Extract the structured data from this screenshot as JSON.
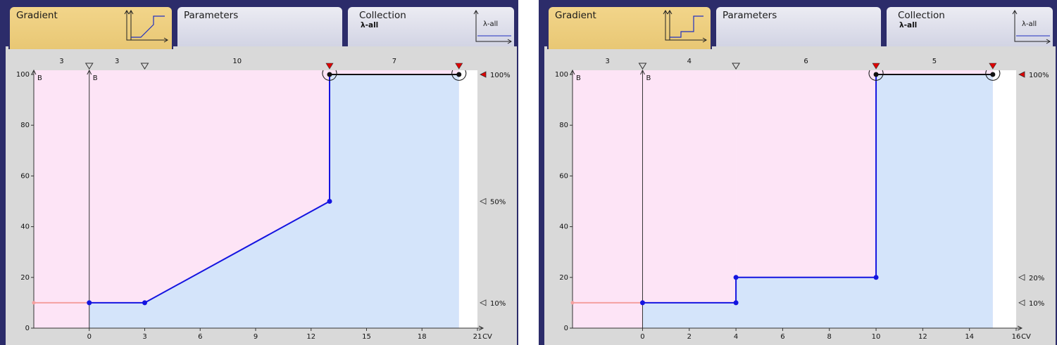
{
  "tabs": {
    "gradient_label": "Gradient",
    "parameters_label": "Parameters",
    "collection_label": "Collection",
    "collection_sub": "λ-all",
    "lambda_icon_text": "λ-all"
  },
  "colors": {
    "frame": "#2c2c6a",
    "active_tab": "#f2d58a",
    "equilibration": "#fde4f6",
    "elution": "#d4e4fa",
    "trace": "#1414e0",
    "marker": "#e00000"
  },
  "axis": {
    "y_label": "B",
    "x_label": "CV",
    "b_label": "B"
  },
  "charts": [
    {
      "type": "line",
      "segment_labels": [
        "3",
        "3",
        "10",
        "7"
      ],
      "segment_label_x": [
        -1.5,
        1.5,
        8,
        16.5
      ],
      "x_ticks": [
        0,
        3,
        6,
        9,
        12,
        15,
        18,
        21
      ],
      "y_ticks": [
        0,
        20,
        40,
        60,
        80,
        100
      ],
      "xlim": [
        -3,
        21
      ],
      "ylim": [
        0,
        100
      ],
      "equilibration_end": 0,
      "shade_end": 20,
      "equilibration_level": 10,
      "points": [
        [
          0,
          10
        ],
        [
          3,
          10
        ],
        [
          13,
          50
        ],
        [
          13,
          100
        ],
        [
          20,
          100
        ]
      ],
      "dot_points": [
        [
          0,
          10
        ],
        [
          3,
          10
        ],
        [
          13,
          50
        ]
      ],
      "black_dots": [
        [
          13,
          100
        ],
        [
          20,
          100
        ]
      ],
      "circled": [
        13,
        20
      ],
      "open_markers": [
        0,
        3
      ],
      "red_markers": [
        13,
        20
      ],
      "right_labels": [
        {
          "value": 100,
          "text": "100%",
          "filled": true
        },
        {
          "value": 50,
          "text": "50%",
          "filled": false
        },
        {
          "value": 10,
          "text": "10%",
          "filled": false
        }
      ]
    },
    {
      "type": "line",
      "segment_labels": [
        "3",
        "4",
        "6",
        "5"
      ],
      "segment_label_x": [
        -1.5,
        2,
        7,
        12.5
      ],
      "x_ticks": [
        0,
        2,
        4,
        6,
        8,
        10,
        12,
        14,
        16
      ],
      "y_ticks": [
        0,
        20,
        40,
        60,
        80,
        100
      ],
      "xlim": [
        -3,
        16
      ],
      "ylim": [
        0,
        100
      ],
      "equilibration_end": 0,
      "shade_end": 15,
      "equilibration_level": 10,
      "points": [
        [
          0,
          10
        ],
        [
          4,
          10
        ],
        [
          4,
          20
        ],
        [
          10,
          20
        ],
        [
          10,
          100
        ],
        [
          15,
          100
        ]
      ],
      "dot_points": [
        [
          0,
          10
        ],
        [
          4,
          10
        ],
        [
          4,
          20
        ],
        [
          10,
          20
        ]
      ],
      "black_dots": [
        [
          10,
          100
        ],
        [
          15,
          100
        ]
      ],
      "circled": [
        10,
        15
      ],
      "open_markers": [
        0,
        4
      ],
      "red_markers": [
        10,
        15
      ],
      "right_labels": [
        {
          "value": 100,
          "text": "100%",
          "filled": true
        },
        {
          "value": 20,
          "text": "20%",
          "filled": false
        },
        {
          "value": 10,
          "text": "10%",
          "filled": false
        }
      ]
    }
  ]
}
